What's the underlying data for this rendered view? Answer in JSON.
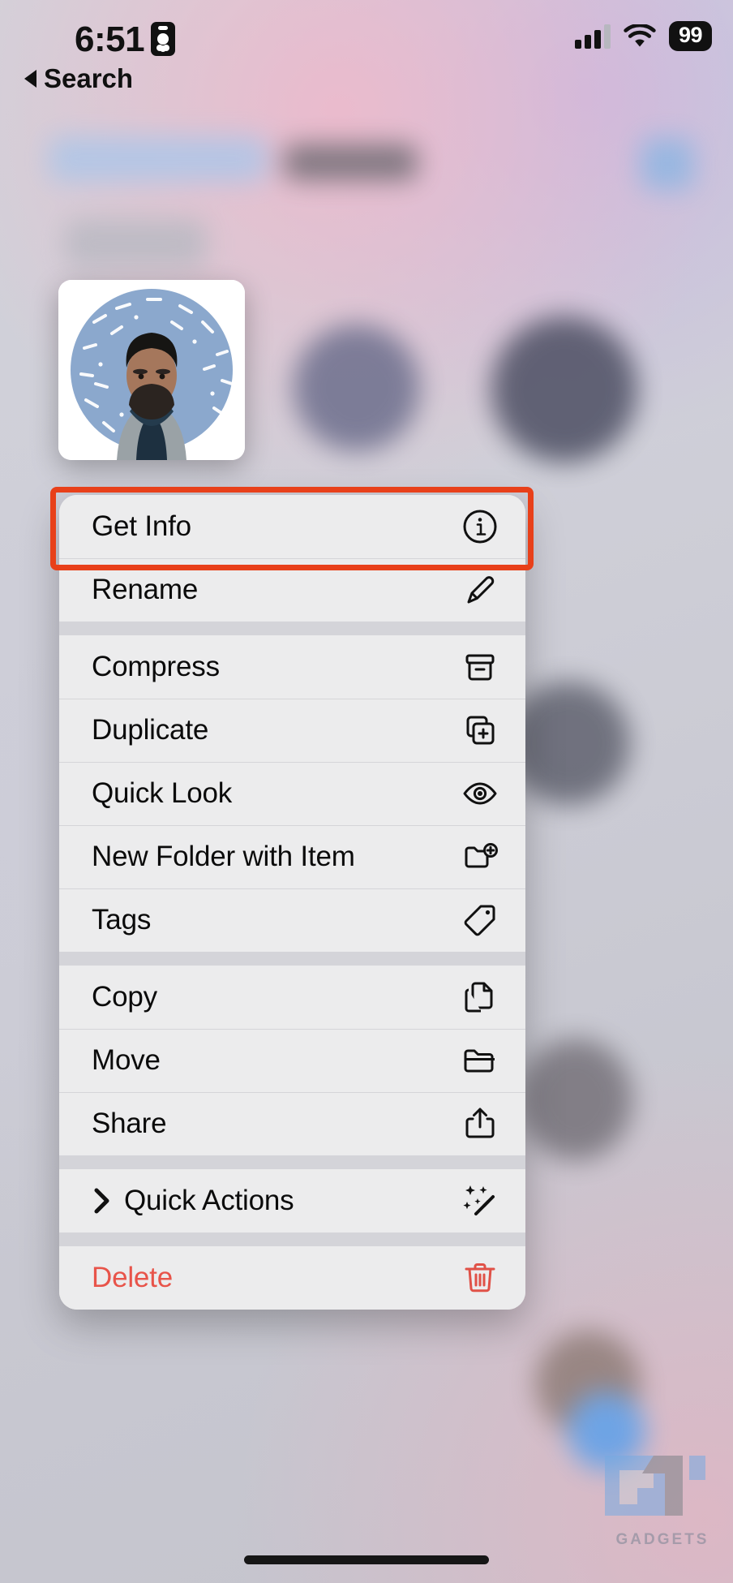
{
  "status_bar": {
    "time": "6:51",
    "recording_icon": "contact-card-icon",
    "signal_icon": "cellular-signal-icon",
    "wifi_icon": "wifi-icon",
    "battery_level": "99"
  },
  "navigation": {
    "back_label": "Search",
    "back_icon": "back-caret-icon"
  },
  "preview": {
    "thumbnail_name": "contact-photo-thumbnail",
    "description": "Contact photo of a bearded man in a grey puffer jacket on a blue confetti circle"
  },
  "highlight": {
    "target": "Get Info",
    "color": "#e8401a"
  },
  "context_menu": {
    "groups": [
      {
        "items": [
          {
            "label": "Get Info",
            "icon": "info-circle-icon",
            "highlighted": true
          },
          {
            "label": "Rename",
            "icon": "pencil-icon"
          }
        ]
      },
      {
        "items": [
          {
            "label": "Compress",
            "icon": "archive-box-icon"
          },
          {
            "label": "Duplicate",
            "icon": "duplicate-plus-icon"
          },
          {
            "label": "Quick Look",
            "icon": "eye-icon"
          },
          {
            "label": "New Folder with Item",
            "icon": "folder-plus-icon"
          },
          {
            "label": "Tags",
            "icon": "tag-icon"
          }
        ]
      },
      {
        "items": [
          {
            "label": "Copy",
            "icon": "copy-documents-icon"
          },
          {
            "label": "Move",
            "icon": "folder-icon"
          },
          {
            "label": "Share",
            "icon": "share-up-arrow-icon"
          }
        ]
      },
      {
        "items": [
          {
            "label": "Quick Actions",
            "icon": "magic-wand-sparkles-icon",
            "lead_icon": "chevron-right-icon"
          }
        ]
      },
      {
        "items": [
          {
            "label": "Delete",
            "icon": "trash-icon",
            "destructive": true
          }
        ]
      }
    ]
  },
  "watermark": {
    "logo": "gt-logo-icon",
    "text": "GADGETS"
  },
  "colors": {
    "highlight": "#e8401a",
    "destructive": "#e8544a",
    "menu_background": "#ececed",
    "menu_separator": "#d5d5d8"
  }
}
